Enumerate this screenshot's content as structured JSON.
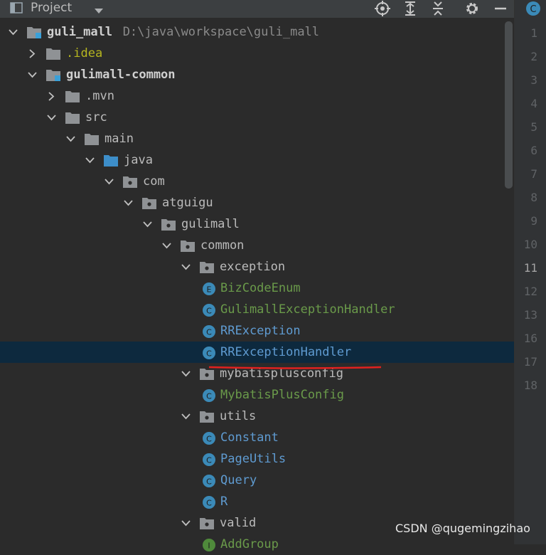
{
  "toolbar": {
    "title": "Project",
    "icons": [
      "project-view-icon",
      "dropdown-caret-icon",
      "locate-icon",
      "expand-all-icon",
      "collapse-all-icon",
      "gear-icon",
      "minimize-icon"
    ]
  },
  "tree": [
    {
      "name": "guli_mall",
      "path": "D:\\java\\workspace\\guli_mall",
      "depth": 0,
      "expanded": true,
      "kind": "module-folder",
      "style": "bold"
    },
    {
      "name": ".idea",
      "depth": 1,
      "expanded": false,
      "kind": "folder",
      "style": "idea"
    },
    {
      "name": "gulimall-common",
      "depth": 1,
      "expanded": true,
      "kind": "module-folder",
      "style": "bold"
    },
    {
      "name": ".mvn",
      "depth": 2,
      "expanded": false,
      "kind": "folder",
      "style": "plain"
    },
    {
      "name": "src",
      "depth": 2,
      "expanded": true,
      "kind": "folder",
      "style": "plain"
    },
    {
      "name": "main",
      "depth": 3,
      "expanded": true,
      "kind": "folder",
      "style": "plain"
    },
    {
      "name": "java",
      "depth": 4,
      "expanded": true,
      "kind": "source-folder",
      "style": "plain"
    },
    {
      "name": "com",
      "depth": 5,
      "expanded": true,
      "kind": "package",
      "style": "plain"
    },
    {
      "name": "atguigu",
      "depth": 6,
      "expanded": true,
      "kind": "package",
      "style": "plain"
    },
    {
      "name": "gulimall",
      "depth": 7,
      "expanded": true,
      "kind": "package",
      "style": "plain"
    },
    {
      "name": "common",
      "depth": 8,
      "expanded": true,
      "kind": "package",
      "style": "plain"
    },
    {
      "name": "exception",
      "depth": 9,
      "expanded": true,
      "kind": "package",
      "style": "plain"
    },
    {
      "name": "BizCodeEnum",
      "depth": 10,
      "kind": "enum",
      "style": "cls-green"
    },
    {
      "name": "GulimallExceptionHandler",
      "depth": 10,
      "kind": "class",
      "style": "cls-green"
    },
    {
      "name": "RRException",
      "depth": 10,
      "kind": "class",
      "style": "cls"
    },
    {
      "name": "RRExceptionHandler",
      "depth": 10,
      "kind": "class",
      "style": "cls",
      "selected": true
    },
    {
      "name": "mybatisplusconfig",
      "depth": 9,
      "expanded": true,
      "kind": "package",
      "style": "plain"
    },
    {
      "name": "MybatisPlusConfig",
      "depth": 10,
      "kind": "class",
      "style": "cls-green"
    },
    {
      "name": "utils",
      "depth": 9,
      "expanded": true,
      "kind": "package",
      "style": "plain"
    },
    {
      "name": "Constant",
      "depth": 10,
      "kind": "class",
      "style": "cls"
    },
    {
      "name": "PageUtils",
      "depth": 10,
      "kind": "class",
      "style": "cls"
    },
    {
      "name": "Query",
      "depth": 10,
      "kind": "class",
      "style": "cls"
    },
    {
      "name": "R",
      "depth": 10,
      "kind": "class",
      "style": "cls"
    },
    {
      "name": "valid",
      "depth": 9,
      "expanded": true,
      "kind": "package",
      "style": "plain"
    },
    {
      "name": "AddGroup",
      "depth": 10,
      "kind": "interface",
      "style": "cls-green"
    }
  ],
  "editor": {
    "tab_icon_letter": "C",
    "line_numbers": [
      "1",
      "2",
      "3",
      "4",
      "5",
      "6",
      "7",
      "8",
      "9",
      "10",
      "11",
      "12",
      "13",
      "16",
      "17",
      "18"
    ],
    "current_line": "11"
  },
  "watermark": "CSDN @qugemingzihao",
  "colors": {
    "background": "#2b2b2b",
    "selection": "#0d293e",
    "class_icon": "#3b8ab8",
    "enum_icon": "#3b8ab8",
    "interface_icon": "#4f8a3b",
    "underline": "#e0211f",
    "folder": "#8f9295",
    "source_folder": "#3d8ec9",
    "module_marker": "#3aa0d8"
  }
}
